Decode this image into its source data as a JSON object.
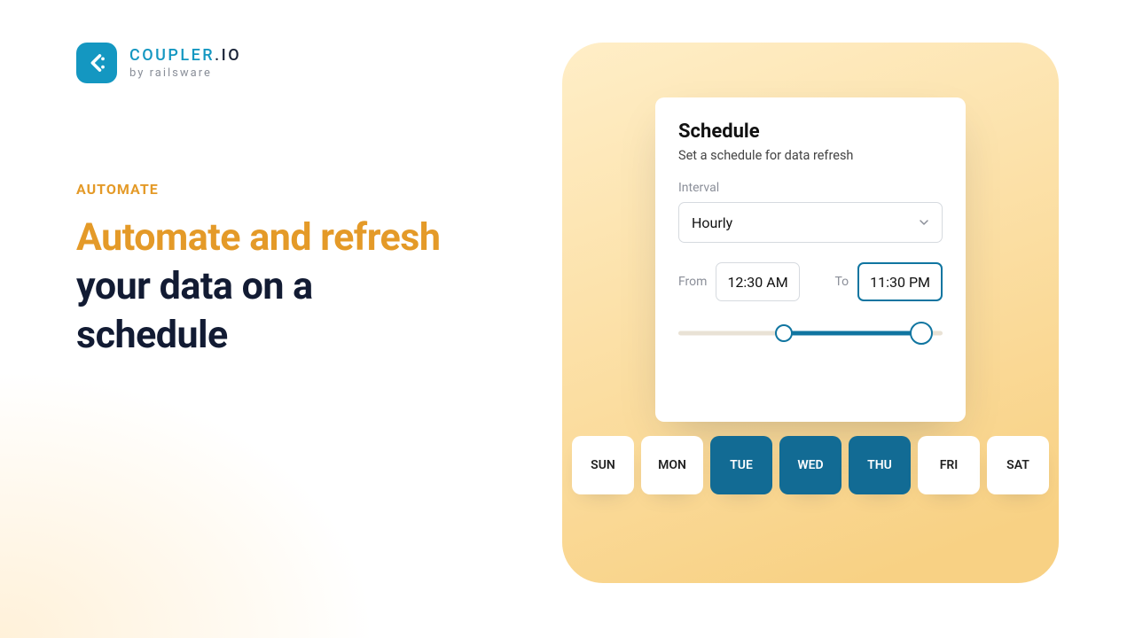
{
  "brand": {
    "name_prefix": "COUPLER",
    "name_suffix": ".IO",
    "byline": "by railsware"
  },
  "hero": {
    "eyebrow": "AUTOMATE",
    "headline_accent": "Automate and refresh",
    "headline_rest": " your data on a schedule"
  },
  "schedule": {
    "title": "Schedule",
    "subtitle": "Set a schedule for data refresh",
    "interval_label": "Interval",
    "interval_value": "Hourly",
    "from_label": "From",
    "from_value": "12:30 AM",
    "to_label": "To",
    "to_value": "11:30 PM",
    "slider": {
      "start_pct": 40,
      "end_pct": 92
    },
    "days": [
      {
        "abbr": "SUN",
        "selected": false
      },
      {
        "abbr": "MON",
        "selected": false
      },
      {
        "abbr": "TUE",
        "selected": true
      },
      {
        "abbr": "WED",
        "selected": true
      },
      {
        "abbr": "THU",
        "selected": true
      },
      {
        "abbr": "FRI",
        "selected": false
      },
      {
        "abbr": "SAT",
        "selected": false
      }
    ]
  }
}
